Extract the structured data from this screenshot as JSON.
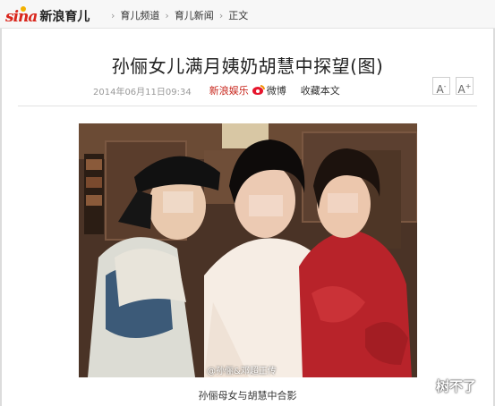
{
  "header": {
    "logo_brand": "sina",
    "logo_channel": "新浪育儿",
    "breadcrumb": [
      "育儿频道",
      "育儿新闻",
      "正文"
    ]
  },
  "article": {
    "title": "孙俪女儿满月姨奶胡慧中探望(图)",
    "time": "2014年06月11日09:34",
    "source": "新浪娱乐",
    "weibo_label": "微博",
    "favorite_label": "收藏本文",
    "font_smaller": "A",
    "font_larger": "A",
    "photo_watermark": "@孙俪&邓超正传",
    "photo_caption": "孙俪母女与胡慧中合影",
    "corner_mark": "树不了"
  },
  "colors": {
    "brand_red": "#d9261c",
    "source_red": "#c8261c",
    "weibo_red": "#e6162d"
  },
  "icons": [
    "sina-eye-logo-icon",
    "chevron-right-icon",
    "weibo-icon",
    "font-decrease-icon",
    "font-increase-icon"
  ]
}
